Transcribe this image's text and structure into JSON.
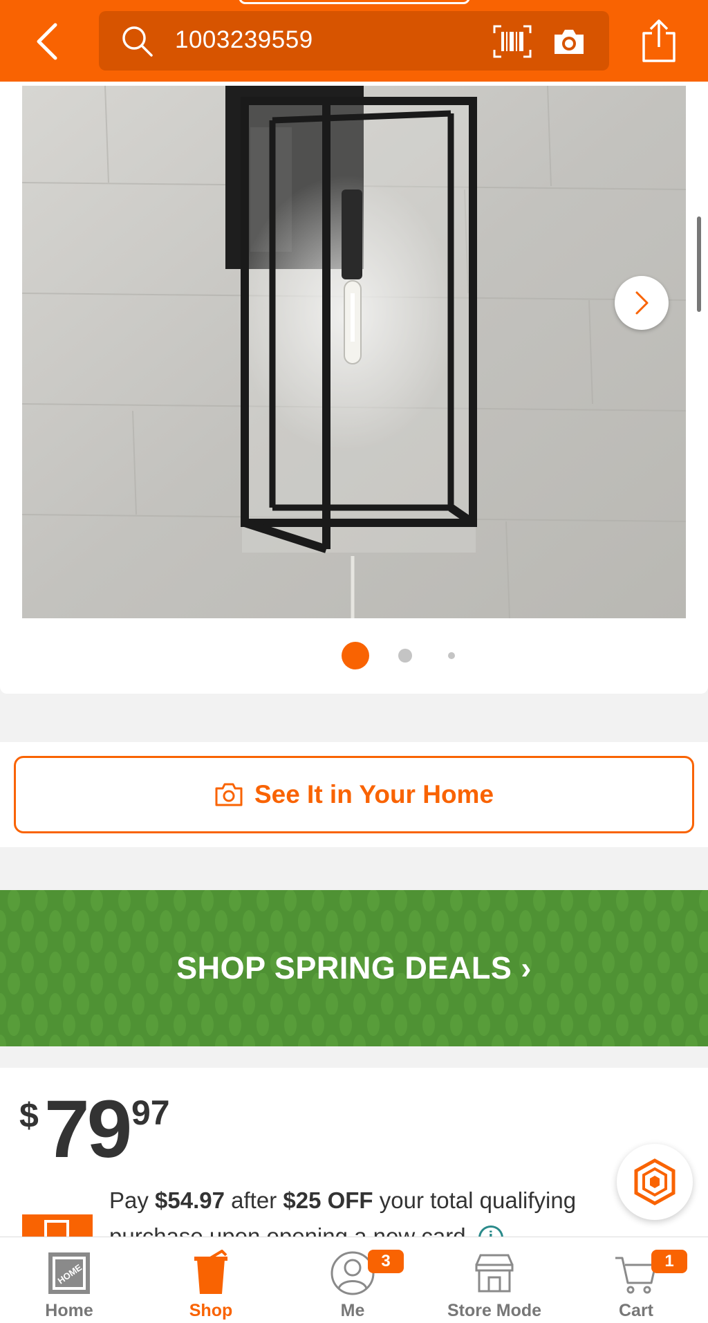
{
  "search": {
    "query": "1003239559"
  },
  "gallery": {
    "image_alt": "Black rectangular outdoor wall lantern with clear glass",
    "slide_count": 3,
    "active_slide": 1
  },
  "see_it": {
    "label": "See It in Your Home"
  },
  "banner": {
    "label": "SHOP SPRING DEALS ›"
  },
  "price": {
    "currency": "$",
    "dollars": "79",
    "cents": "97"
  },
  "promo": {
    "pre": "Pay ",
    "amount": "$54.97",
    "mid": " after ",
    "discount": "$25 OFF",
    "post": " your total qualifying purchase upon opening a new card."
  },
  "nav": [
    {
      "label": "Home",
      "active": false
    },
    {
      "label": "Shop",
      "active": true
    },
    {
      "label": "Me",
      "badge": "3"
    },
    {
      "label": "Store Mode"
    },
    {
      "label": "Cart",
      "badge": "1"
    }
  ],
  "colors": {
    "brand_orange": "#f96302",
    "search_bg": "#d75400",
    "banner_green": "#4f9234"
  }
}
